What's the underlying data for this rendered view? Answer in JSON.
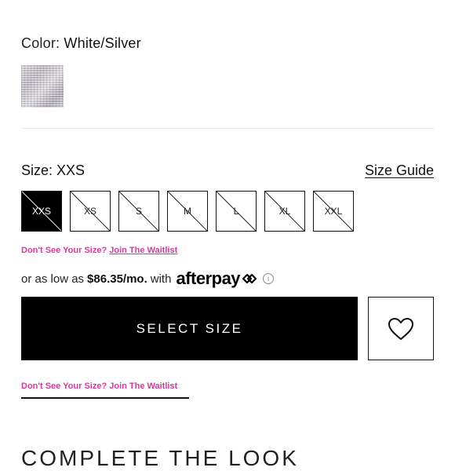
{
  "color": {
    "label": "Color:",
    "value": "White/Silver",
    "swatch_name": "White/Silver swatch"
  },
  "size": {
    "label": "Size:",
    "selected": "XXS",
    "guide_label": "Size Guide",
    "options": [
      "XXS",
      "XS",
      "S",
      "M",
      "L",
      "XL",
      "XXL"
    ]
  },
  "waitlist_top": {
    "question": "Don't See Your Size?",
    "link": "Join The Waitlist"
  },
  "afterpay": {
    "prefix": "or as low as",
    "price": "$86.35/mo.",
    "with": "with",
    "brand": "afterpay",
    "info_symbol": "i"
  },
  "actions": {
    "select_size": "SELECT SIZE",
    "wishlist_icon": "heart-icon"
  },
  "waitlist_bottom": {
    "text": "Don't See Your Size? Join The Waitlist"
  },
  "section": {
    "complete_look": "COMPLETE THE LOOK"
  },
  "colors": {
    "accent_pink": "#d4399b",
    "button_black": "#000000"
  }
}
